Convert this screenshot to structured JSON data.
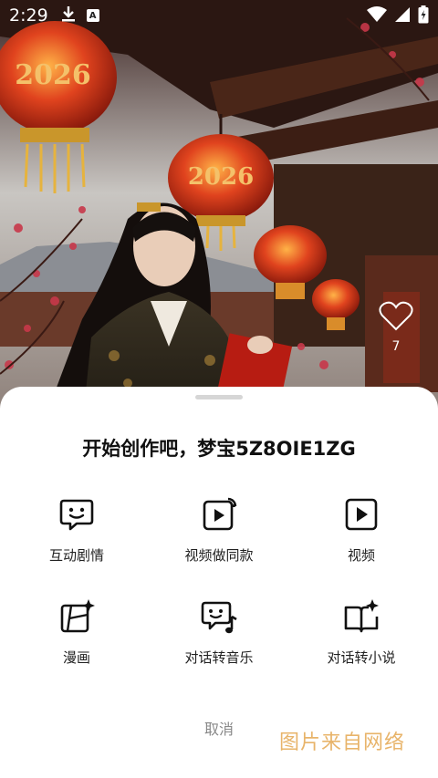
{
  "status_bar": {
    "time": "2:29",
    "notification_badge": "A",
    "icons": [
      "download-icon",
      "a-badge-icon",
      "wifi-icon",
      "signal-icon",
      "battery-charging-icon"
    ]
  },
  "background": {
    "lantern_text_1": "2026",
    "lantern_text_2": "2026",
    "like_count": "7"
  },
  "sheet": {
    "title": "开始创作吧，梦宝5Z8OIE1ZG",
    "items": [
      {
        "label": "互动剧情",
        "icon": "chat-face-icon"
      },
      {
        "label": "视频做同款",
        "icon": "video-remix-icon"
      },
      {
        "label": "视频",
        "icon": "video-play-icon"
      },
      {
        "label": "漫画",
        "icon": "comic-sparkle-icon"
      },
      {
        "label": "对话转音乐",
        "icon": "chat-music-icon"
      },
      {
        "label": "对话转小说",
        "icon": "book-sparkle-icon"
      }
    ],
    "cancel_label": "取消"
  },
  "watermark": "图片来自网络"
}
